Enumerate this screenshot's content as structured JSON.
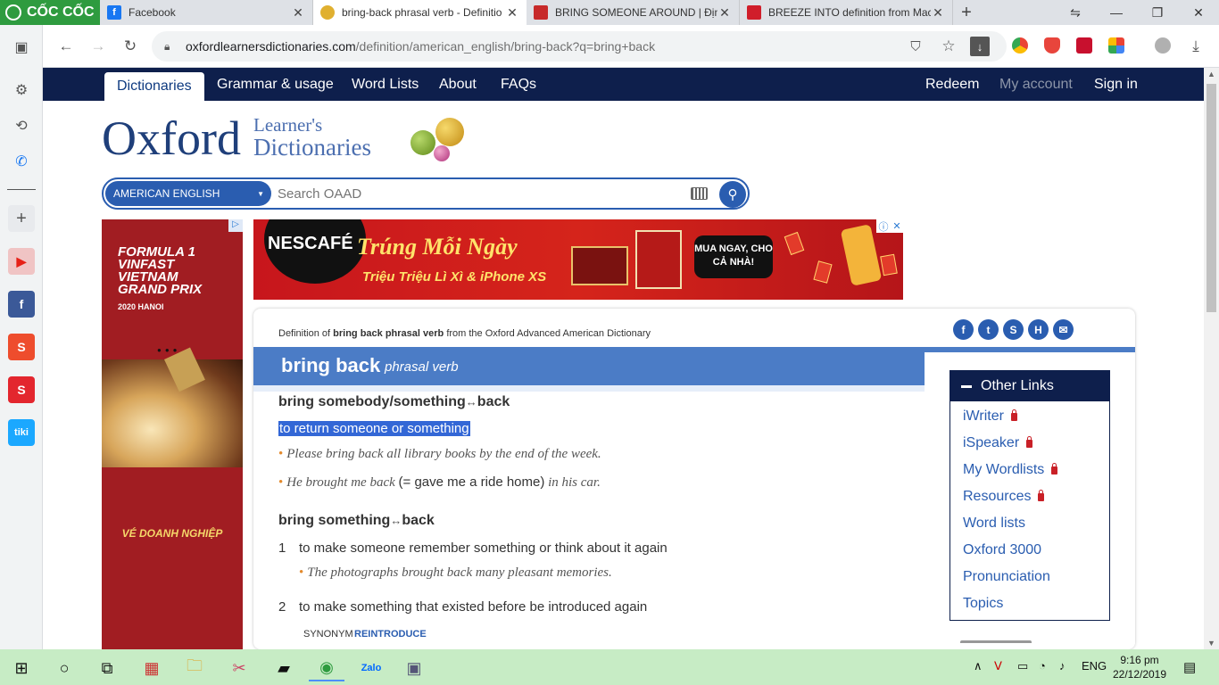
{
  "browser": {
    "brand": "CỐC CỐC",
    "tabs": [
      {
        "title": "Facebook",
        "icon": "facebook-icon",
        "color": "#1877f2"
      },
      {
        "title": "bring-back phrasal verb - Definitio",
        "icon": "oxford-icon",
        "color": "#e0b030"
      },
      {
        "title": "BRING SOMEONE AROUND | Định",
        "icon": "cambridge-icon",
        "color": "#c72a2a"
      },
      {
        "title": "BREEZE INTO definition from Macr",
        "icon": "macmillan-icon",
        "color": "#d01e2b"
      }
    ],
    "url_domain": "oxfordlearnersdictionaries.com",
    "url_path": "/definition/american_english/bring-back?q=bring+back"
  },
  "site": {
    "nav_left": [
      "Dictionaries",
      "Grammar & usage",
      "Word Lists",
      "About",
      "FAQs"
    ],
    "nav_right": [
      "Redeem",
      "My account",
      "Sign in"
    ],
    "logo_main": "Oxford",
    "logo_learners": "Learner's",
    "logo_dictionaries": "Dictionaries"
  },
  "search": {
    "dictionary": "AMERICAN ENGLISH",
    "placeholder": "Search OAAD"
  },
  "ads": {
    "left_f1": "FORMULA 1 VINFAST VIETNAM GRAND PRIX",
    "left_f1_year": "2020 HANOI",
    "left_bottom": "VÉ DOANH NGHIỆP",
    "banner_brand": "NESCAFÉ",
    "banner_headline": "Trúng Mỗi Ngày",
    "banner_sub": "Triệu Triệu Lì Xì & iPhone XS",
    "banner_cta": "MUA NGAY, CHO CẢ NHÀ!"
  },
  "entry": {
    "source_prefix": "Definition of ",
    "source_word": "bring back phrasal verb",
    "source_suffix": " from the Oxford Advanced American Dictionary",
    "headword": "bring back",
    "pos": "phrasal verb",
    "phrase1": "bring somebody/something",
    "phrase1_tail": "back",
    "def1": "to return someone or something",
    "ex1": "Please bring back all library books by the end of the week.",
    "ex2_a": "He brought me back",
    "ex2_gloss": "(= gave me a ride home)",
    "ex2_b": "in his car.",
    "phrase2": "bring something",
    "phrase2_tail": "back",
    "sense1_num": "1",
    "sense1": "to make someone remember something or think about it again",
    "sense1_ex": "The photographs brought back many pleasant memories.",
    "sense2_num": "2",
    "sense2": "to make something that existed before be introduced again",
    "synonym_label": "SYNONYM",
    "synonym_word": "REINTRODUCE"
  },
  "other_links": {
    "title": "Other Links",
    "items": [
      "iWriter",
      "iSpeaker",
      "My Wordlists",
      "Resources",
      "Word lists",
      "Oxford 3000",
      "Pronunciation",
      "Topics"
    ]
  },
  "taskbar": {
    "language": "ENG",
    "time": "9:16 pm",
    "date": "22/12/2019"
  }
}
